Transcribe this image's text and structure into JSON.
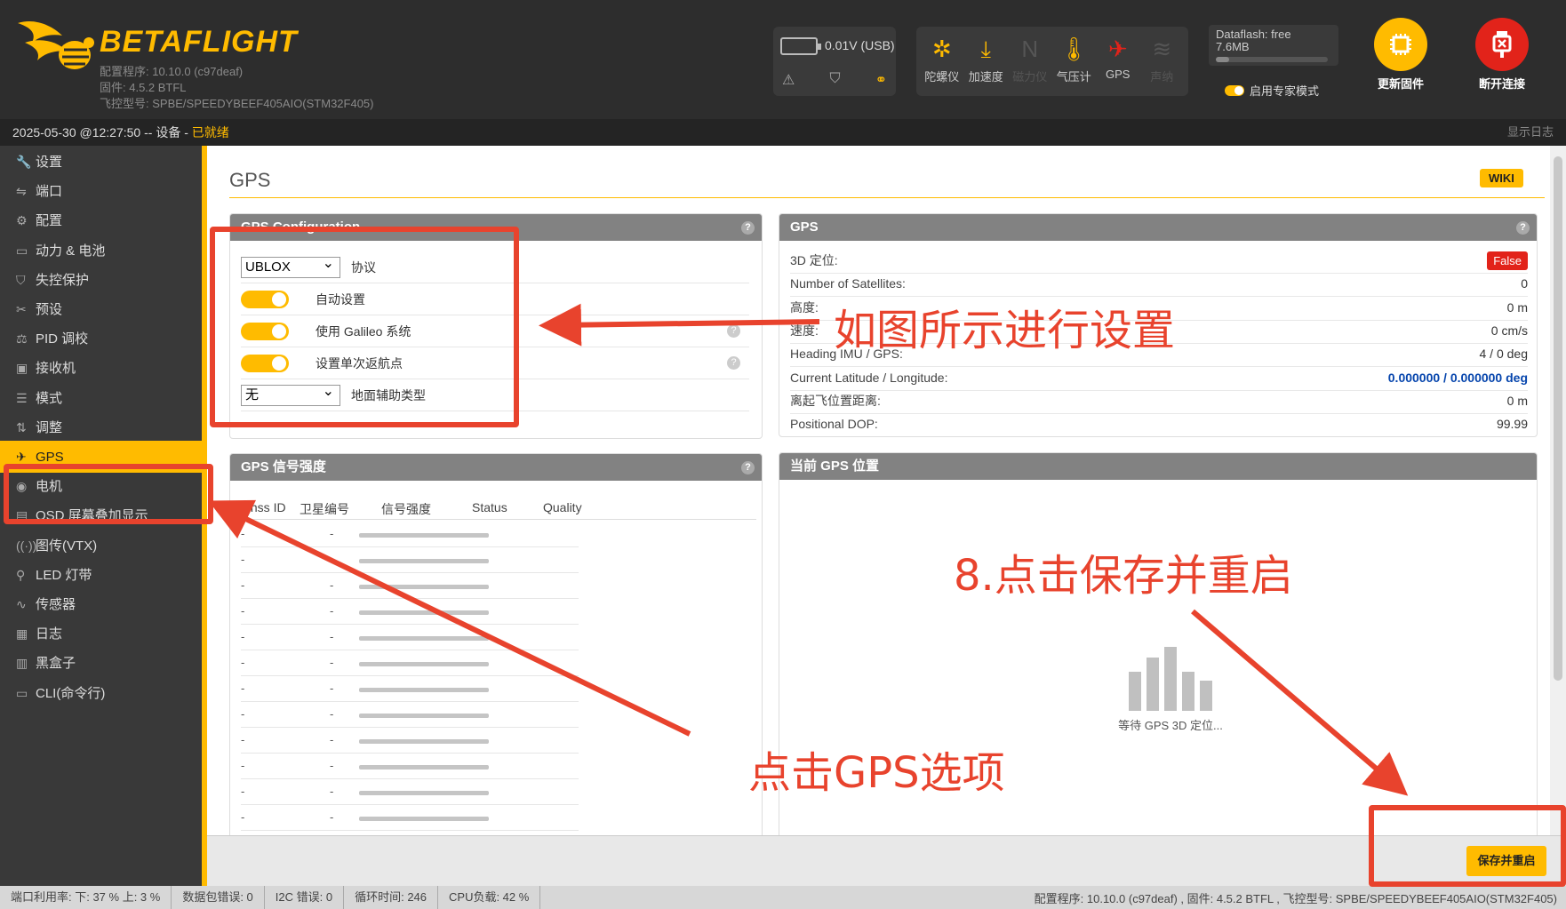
{
  "header": {
    "logo_text": "BETAFLIGHT",
    "configurator_version": "配置程序: 10.10.0 (c97deaf)",
    "firmware": "固件: 4.5.2 BTFL",
    "board": "飞控型号: SPBE/SPEEDYBEEF405AIO(STM32F405)",
    "battery": "0.01V (USB)",
    "sensors": [
      {
        "name": "gyro-icon",
        "label": "陀螺仪",
        "glyph": "✲",
        "active": true
      },
      {
        "name": "accel-icon",
        "label": "加速度",
        "glyph": "⤓",
        "active": true
      },
      {
        "name": "mag-icon",
        "label": "磁力仪",
        "glyph": "N",
        "active": false
      },
      {
        "name": "baro-icon",
        "label": "气压计",
        "glyph": "🌡",
        "active": true
      },
      {
        "name": "gps-icon",
        "label": "GPS",
        "glyph": "✈",
        "active": true,
        "error": true
      },
      {
        "name": "sonar-icon",
        "label": "声纳",
        "glyph": "≋",
        "active": false
      }
    ],
    "dataflash": "Dataflash: free",
    "dataflash_size": "7.6MB",
    "expert_mode": "启用专家模式",
    "update_firmware": "更新固件",
    "disconnect": "断开连接"
  },
  "statusline": {
    "prefix": "2025-05-30 @12:27:50 -- 设备 - ",
    "state": "已就绪",
    "show_log": "显示日志"
  },
  "sidebar": {
    "items": [
      {
        "label": "设置",
        "icon": "🔧"
      },
      {
        "label": "端口",
        "icon": "⇋"
      },
      {
        "label": "配置",
        "icon": "⚙"
      },
      {
        "label": "动力 & 电池",
        "icon": "▭"
      },
      {
        "label": "失控保护",
        "icon": "⛉"
      },
      {
        "label": "预设",
        "icon": "✂"
      },
      {
        "label": "PID 调校",
        "icon": "⚖"
      },
      {
        "label": "接收机",
        "icon": "▣"
      },
      {
        "label": "模式",
        "icon": "☰"
      },
      {
        "label": "调整",
        "icon": "⇅"
      },
      {
        "label": "GPS",
        "icon": "✈"
      },
      {
        "label": "电机",
        "icon": "◉"
      },
      {
        "label": "OSD 屏幕叠加显示",
        "icon": "▤"
      },
      {
        "label": "图传(VTX)",
        "icon": "((·))"
      },
      {
        "label": "LED 灯带",
        "icon": "⚲"
      },
      {
        "label": "传感器",
        "icon": "∿"
      },
      {
        "label": "日志",
        "icon": "▦"
      },
      {
        "label": "黑盒子",
        "icon": "▥"
      },
      {
        "label": "CLI(命令行)",
        "icon": "▭"
      }
    ],
    "active_index": 10
  },
  "main": {
    "title": "GPS",
    "wiki": "WIKI",
    "config_panel": {
      "title": "GPS Configuration",
      "protocol_value": "UBLOX",
      "protocol_label": "协议",
      "auto_config": "自动设置",
      "galileo": "使用 Galileo 系统",
      "home_once": "设置单次返航点",
      "ground_assist_value": "无",
      "ground_assist_label": "地面辅助类型"
    },
    "signal_panel": {
      "title": "GPS 信号强度",
      "columns": [
        "Gnss ID",
        "卫星编号",
        "信号强度",
        "Status",
        "Quality"
      ],
      "rows": [
        "-",
        "-",
        "-",
        "-",
        "-",
        "-",
        "-",
        "-",
        "-",
        "-",
        "-",
        "-"
      ]
    },
    "gps_panel": {
      "title": "GPS",
      "rows": [
        {
          "label": "3D 定位:",
          "value": "False"
        },
        {
          "label": "Number of Satellites:",
          "value": "0"
        },
        {
          "label": "高度:",
          "value": "0 m"
        },
        {
          "label": "速度:",
          "value": "0 cm/s"
        },
        {
          "label": "Heading IMU / GPS:",
          "value": "4 / 0 deg"
        },
        {
          "label": "Current Latitude / Longitude:",
          "value": "0.000000 / 0.000000 deg"
        },
        {
          "label": "离起飞位置距离:",
          "value": "0 m"
        },
        {
          "label": "Positional DOP:",
          "value": "99.99"
        }
      ]
    },
    "position_panel": {
      "title": "当前 GPS 位置",
      "waiting": "等待 GPS 3D 定位..."
    },
    "save_button": "保存并重启"
  },
  "statusbar": {
    "port_util": "端口利用率: 下: 37 % 上: 3 %",
    "packet_error": "数据包错误: 0",
    "i2c_error": "I2C 错误: 0",
    "cycle_time": "循环时间: 246",
    "cpu_load": "CPU负载: 42 %",
    "right": "配置程序: 10.10.0 (c97deaf) , 固件: 4.5.2 BTFL , 飞控型号: SPBE/SPEEDYBEEF405AIO(STM32F405)"
  },
  "annotations": {
    "settings_hint": "如图所示进行设置",
    "click_gps": "点击GPS选项",
    "save_hint": "8.点击保存并重启"
  },
  "colors": {
    "accent": "#ffbb00",
    "annotation": "#e8432d",
    "error": "#e2231a"
  }
}
